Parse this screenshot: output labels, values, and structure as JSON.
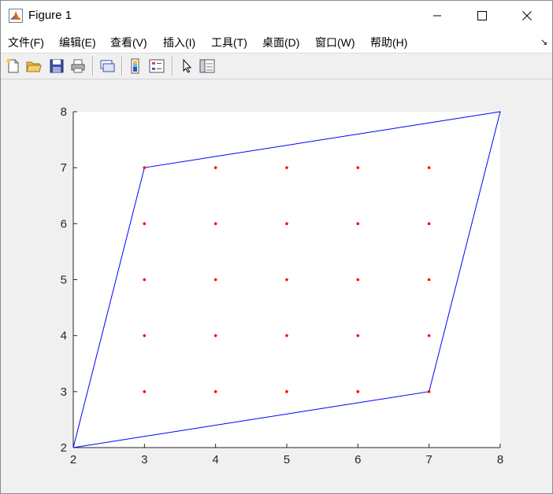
{
  "window": {
    "title": "Figure 1"
  },
  "menu": [
    "文件(F)",
    "编辑(E)",
    "查看(V)",
    "插入(I)",
    "工具(T)",
    "桌面(D)",
    "窗口(W)",
    "帮助(H)"
  ],
  "toolbar": {
    "icons": [
      "new-figure-icon",
      "open-file-icon",
      "save-icon",
      "print-icon",
      "link-plot-icon",
      "insert-colorbar-icon",
      "insert-legend-icon",
      "edit-plot-arrow-icon",
      "property-inspector-icon"
    ]
  },
  "colors": {
    "polygon": "#0000ff",
    "points": "#ff0000",
    "axes_bg": "#ffffff",
    "figure_bg": "#f0f0f0"
  },
  "chart_data": {
    "type": "scatter",
    "title": "",
    "xlabel": "",
    "ylabel": "",
    "xlim": [
      2,
      8
    ],
    "ylim": [
      2,
      8
    ],
    "xticks": [
      2,
      3,
      4,
      5,
      6,
      7,
      8
    ],
    "yticks": [
      2,
      3,
      4,
      5,
      6,
      7,
      8
    ],
    "grid": false,
    "series": [
      {
        "type": "line",
        "color": "#0000ff",
        "x": [
          2,
          3,
          8,
          7,
          2
        ],
        "y": [
          2,
          7,
          8,
          3,
          2
        ]
      },
      {
        "type": "scatter",
        "color": "#ff0000",
        "points": [
          [
            3,
            3
          ],
          [
            4,
            3
          ],
          [
            5,
            3
          ],
          [
            6,
            3
          ],
          [
            7,
            3
          ],
          [
            3,
            4
          ],
          [
            4,
            4
          ],
          [
            5,
            4
          ],
          [
            6,
            4
          ],
          [
            7,
            4
          ],
          [
            3,
            5
          ],
          [
            4,
            5
          ],
          [
            5,
            5
          ],
          [
            6,
            5
          ],
          [
            7,
            5
          ],
          [
            3,
            6
          ],
          [
            4,
            6
          ],
          [
            5,
            6
          ],
          [
            6,
            6
          ],
          [
            7,
            6
          ],
          [
            3,
            7
          ],
          [
            4,
            7
          ],
          [
            5,
            7
          ],
          [
            6,
            7
          ],
          [
            7,
            7
          ]
        ]
      }
    ]
  }
}
